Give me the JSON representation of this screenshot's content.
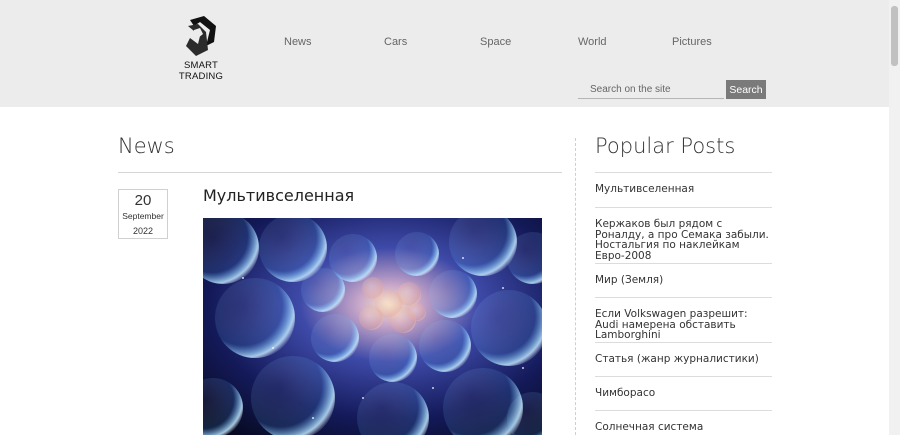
{
  "header": {
    "logo_text": "SMART\nTRADING",
    "nav": [
      "News",
      "Cars",
      "Space",
      "World",
      "Pictures"
    ],
    "search_placeholder": "Search on the site",
    "search_button": "Search"
  },
  "main": {
    "section_title": "News",
    "post": {
      "day": "20",
      "month": "September",
      "year": "2022",
      "title": "Мультивселенная"
    }
  },
  "sidebar": {
    "title": "Popular Posts",
    "items": [
      "Мультивселенная",
      "Кержаков был рядом с Роналду, а про Семака забыли. Ностальгия по наклейкам Евро-2008",
      "Мир (Земля)",
      "Если Volkswagen разрешит: Audi намерена обставить Lamborghini",
      "Статья (жанр журналистики)",
      "Чимборасо",
      "Солнечная система"
    ]
  },
  "colors": {
    "header_bg": "#ececec",
    "search_button_bg": "#7a7a7a"
  }
}
